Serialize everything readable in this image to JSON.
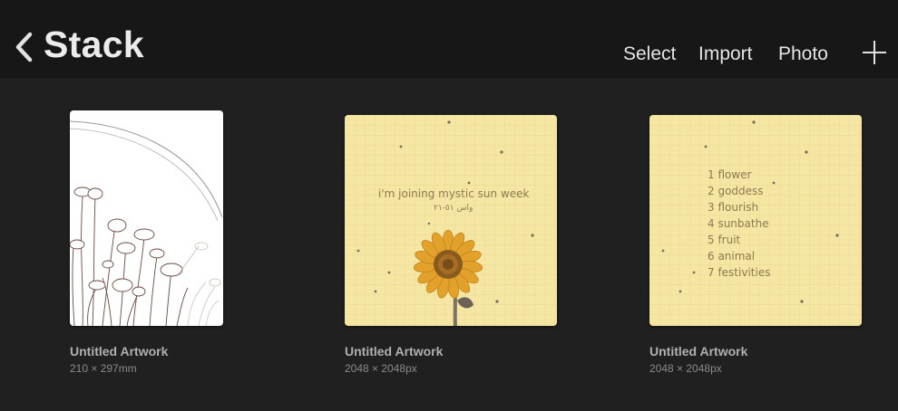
{
  "header": {
    "title": "Stack",
    "back_icon": "chevron-left-icon",
    "actions": {
      "select": "Select",
      "import": "Import",
      "photo": "Photo"
    },
    "add_icon": "plus-icon"
  },
  "artworks": [
    {
      "name": "Untitled Artwork",
      "size": "210 × 297mm",
      "thumb": "flower-sketch"
    },
    {
      "name": "Untitled Artwork",
      "size": "2048 × 2048px",
      "thumb": "sunflower",
      "caption": "i'm joining mystic sun week",
      "subcaption": "واس ٥١-٢١"
    },
    {
      "name": "Untitled Artwork",
      "size": "2048 × 2048px",
      "thumb": "list",
      "list": [
        "1 flower",
        "2 goddess",
        "3 flourish",
        "4 sunbathe",
        "5 fruit",
        "6 animal",
        "7 festivities"
      ]
    }
  ],
  "colors": {
    "background": "#202020",
    "topbar": "#171717",
    "paper_yellow": "#f5e6a3",
    "text_brown": "#8e7a52"
  }
}
